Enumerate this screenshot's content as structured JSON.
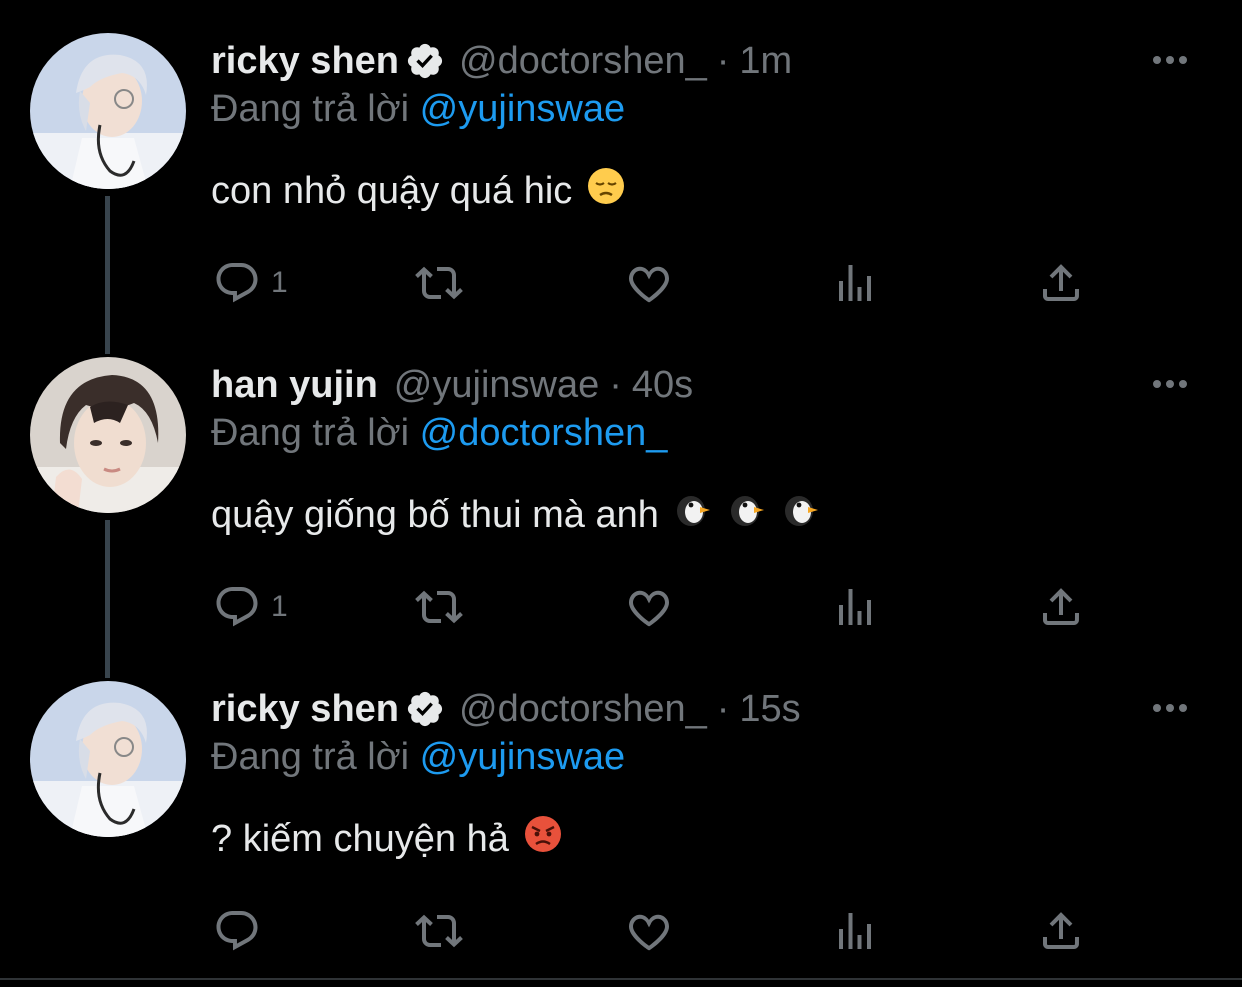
{
  "thread": [
    {
      "display_name": "ricky shen",
      "verified": true,
      "handle": "@doctorshen_",
      "separator": "·",
      "time": "1m",
      "replying_prefix": "Đang trả lời",
      "replying_to": "@yujinswae",
      "text": "con nhỏ quậy quá hic",
      "emojis": [
        "pensive-face"
      ],
      "reply_count": "1",
      "avatar_icon": "avatar-silver-hair-stethoscope"
    },
    {
      "display_name": "han yujin",
      "verified": false,
      "handle": "@yujinswae",
      "separator": "·",
      "time": "40s",
      "replying_prefix": "Đang trả lời",
      "replying_to": "@doctorshen_",
      "text": "quậy giống bố thui mà anh",
      "emojis": [
        "penguin",
        "penguin",
        "penguin"
      ],
      "reply_count": "1",
      "avatar_icon": "avatar-dark-hair"
    },
    {
      "display_name": "ricky shen",
      "verified": true,
      "handle": "@doctorshen_",
      "separator": "·",
      "time": "15s",
      "replying_prefix": "Đang trả lời",
      "replying_to": "@yujinswae",
      "text": "? kiếm chuyện hả",
      "emojis": [
        "pouting-face"
      ],
      "reply_count": "",
      "avatar_icon": "avatar-silver-hair-stethoscope"
    }
  ],
  "icons": {
    "reply": "reply-icon",
    "retweet": "retweet-icon",
    "like": "heart-icon",
    "views": "views-icon",
    "share": "share-icon",
    "more": "more-icon",
    "verified": "verified-icon"
  },
  "colors": {
    "background": "#000000",
    "text": "#e7e9ea",
    "secondary": "#71767b",
    "accent": "#1d9bf0",
    "thread_line": "#38444d"
  }
}
